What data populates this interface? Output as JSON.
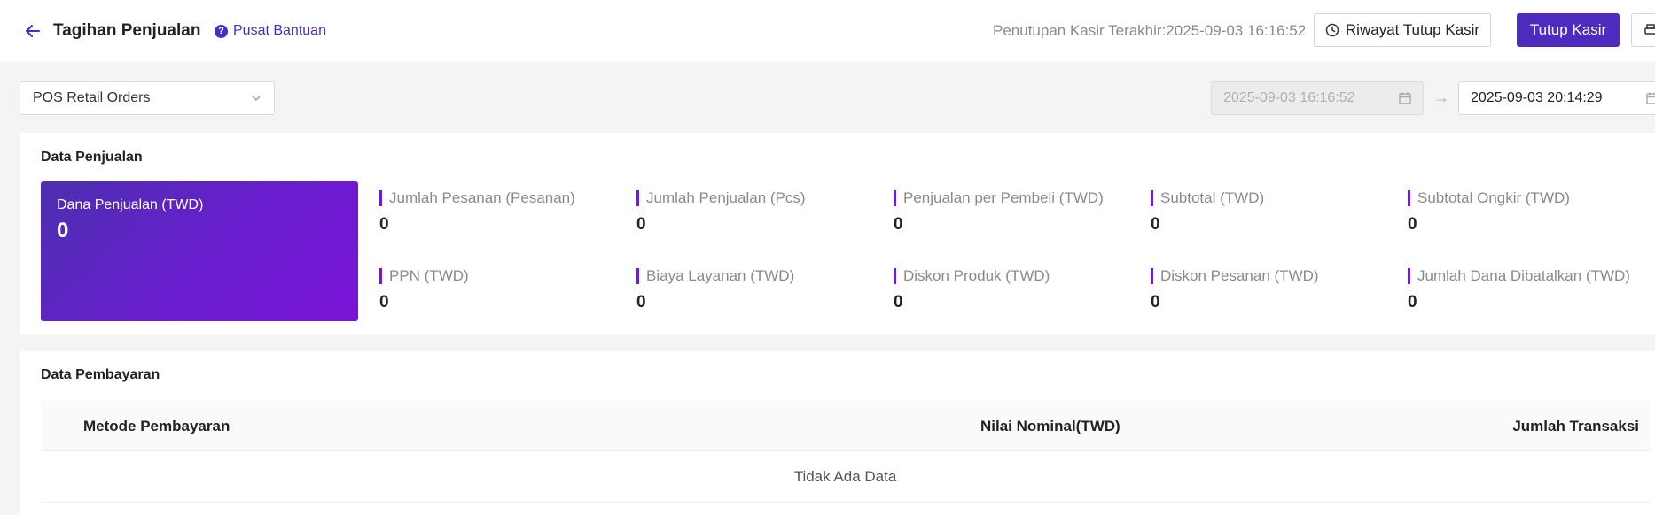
{
  "header": {
    "title": "Tagihan Penjualan",
    "help_label": "Pusat Bantuan",
    "last_close_text": "Penutupan Kasir Terakhir:2025-09-03 16:16:52",
    "history_button": "Riwayat Tutup Kasir",
    "close_button": "Tutup Kasir"
  },
  "filters": {
    "order_type": "POS Retail Orders",
    "date_start": "2025-09-03 16:16:52",
    "date_end": "2025-09-03 20:14:29"
  },
  "sales": {
    "title": "Data Penjualan",
    "hero": {
      "label": "Dana Penjualan (TWD)",
      "value": "0"
    },
    "metrics": [
      {
        "label": "Jumlah Pesanan (Pesanan)",
        "value": "0"
      },
      {
        "label": "Jumlah Penjualan (Pcs)",
        "value": "0"
      },
      {
        "label": "Penjualan per Pembeli (TWD)",
        "value": "0"
      },
      {
        "label": "Subtotal (TWD)",
        "value": "0"
      },
      {
        "label": "Subtotal Ongkir (TWD)",
        "value": "0"
      },
      {
        "label": "PPN (TWD)",
        "value": "0"
      },
      {
        "label": "Biaya Layanan (TWD)",
        "value": "0"
      },
      {
        "label": "Diskon Produk (TWD)",
        "value": "0"
      },
      {
        "label": "Diskon Pesanan (TWD)",
        "value": "0"
      },
      {
        "label": "Jumlah Dana Dibatalkan (TWD)",
        "value": "0"
      }
    ]
  },
  "payments": {
    "title": "Data Pembayaran",
    "columns": [
      "Metode Pembayaran",
      "Nilai Nominal(TWD)",
      "Jumlah Transaksi"
    ],
    "empty_text": "Tidak Ada Data"
  },
  "colors": {
    "accent": "#4c2cbf",
    "hero_gradient_end": "#7a14d8"
  }
}
